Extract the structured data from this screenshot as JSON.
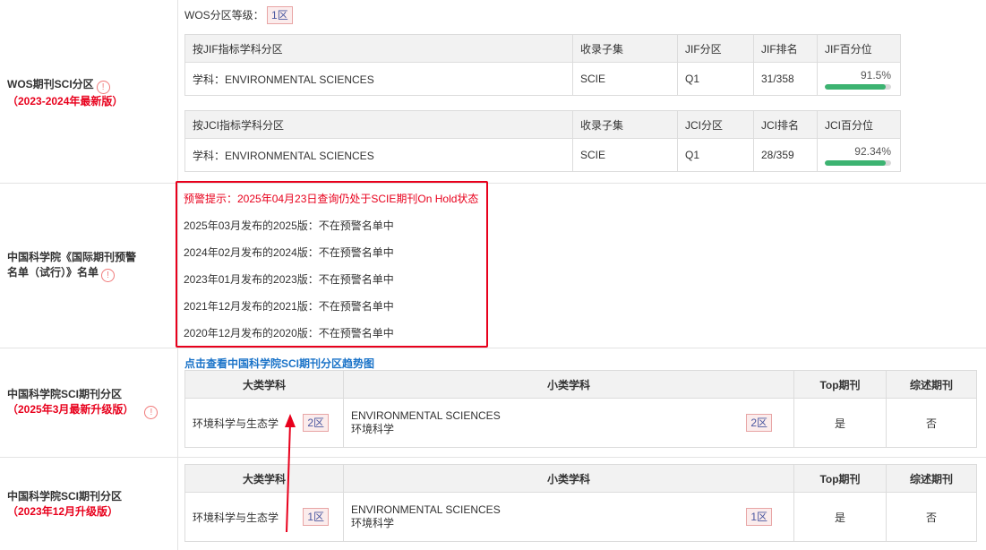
{
  "wos": {
    "label": "WOS期刊SCI分区",
    "label_sub": "（2023-2024年最新版）",
    "grade_label": "WOS分区等级：",
    "grade_value": "1区",
    "jif_table": {
      "headers": [
        "按JIF指标学科分区",
        "收录子集",
        "JIF分区",
        "JIF排名",
        "JIF百分位"
      ],
      "row": {
        "subject": "学科：ENVIRONMENTAL SCIENCES",
        "subset": "SCIE",
        "zone": "Q1",
        "rank": "31/358",
        "percentile_text": "91.5%",
        "percentile": 91.5
      }
    },
    "jci_table": {
      "headers": [
        "按JCI指标学科分区",
        "收录子集",
        "JCI分区",
        "JCI排名",
        "JCI百分位"
      ],
      "row": {
        "subject": "学科：ENVIRONMENTAL SCIENCES",
        "subset": "SCIE",
        "zone": "Q1",
        "rank": "28/359",
        "percentile_text": "92.34%",
        "percentile": 92.34
      }
    }
  },
  "cas_warning": {
    "label_line1": "中国科学院《国际期刊预警",
    "label_line2": "名单（试行）》名单",
    "alert": "预警提示：2025年04月23日查询仍处于SCIE期刊On Hold状态",
    "lines": [
      "2025年03月发布的2025版：不在预警名单中",
      "2024年02月发布的2024版：不在预警名单中",
      "2023年01月发布的2023版：不在预警名单中",
      "2021年12月发布的2021版：不在预警名单中",
      "2020年12月发布的2020版：不在预警名单中"
    ]
  },
  "cas_2025": {
    "label": "中国科学院SCI期刊分区",
    "label_sub": "（2025年3月最新升级版）",
    "trend_link": "点击查看中国科学院SCI期刊分区趋势图",
    "headers": [
      "大类学科",
      "小类学科",
      "Top期刊",
      "综述期刊"
    ],
    "row": {
      "major": "环境科学与生态学",
      "major_zone": "2区",
      "minor_en": "ENVIRONMENTAL SCIENCES",
      "minor_cn": "环境科学",
      "minor_zone": "2区",
      "top": "是",
      "review": "否"
    }
  },
  "cas_2023": {
    "label": "中国科学院SCI期刊分区",
    "label_sub": "（2023年12月升级版）",
    "headers": [
      "大类学科",
      "小类学科",
      "Top期刊",
      "综述期刊"
    ],
    "row": {
      "major": "环境科学与生态学",
      "major_zone": "1区",
      "minor_en": "ENVIRONMENTAL SCIENCES",
      "minor_cn": "环境科学",
      "minor_zone": "1区",
      "top": "是",
      "review": "否"
    }
  },
  "colors": {
    "alert_red": "#e8001c",
    "link_blue": "#1a73c8",
    "bar_green": "#3cb371"
  }
}
